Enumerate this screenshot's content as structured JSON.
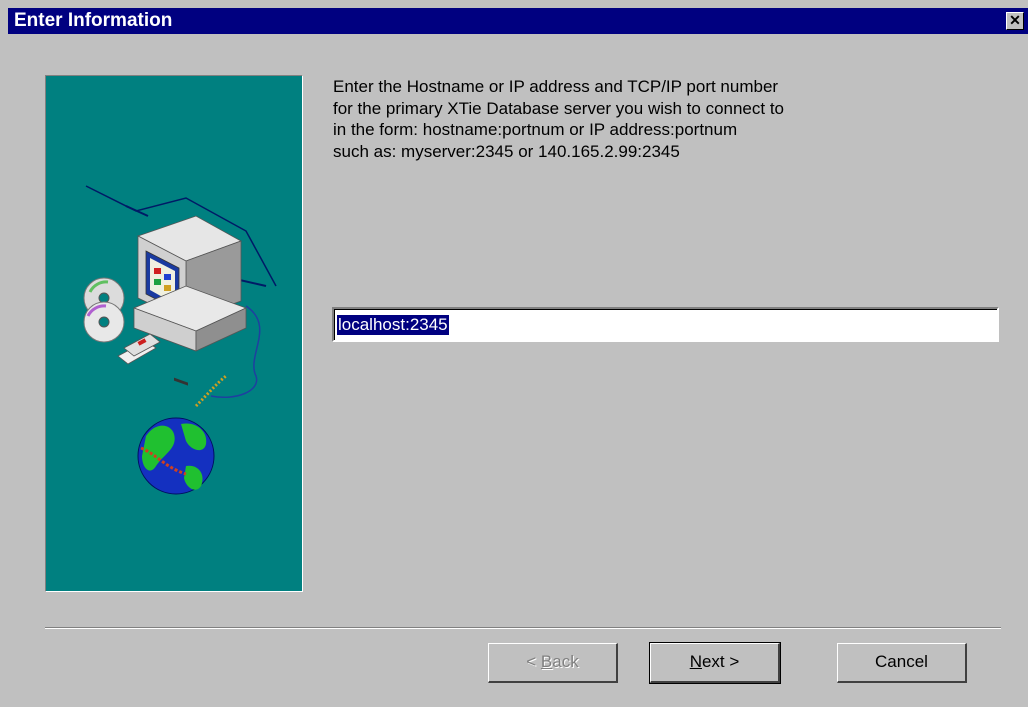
{
  "window": {
    "title": "Enter Information",
    "close_glyph": "✕"
  },
  "instructions": {
    "lines": [
      "Enter the Hostname or IP address and TCP/IP port number",
      "for the primary XTie Database server you wish to connect to",
      "in the form: hostname:portnum or IP address:portnum",
      "such as: myserver:2345 or 140.165.2.99:2345"
    ]
  },
  "host_field": {
    "value": "localhost:2345"
  },
  "buttons": {
    "back_prefix": "< ",
    "back_mnemonic": "B",
    "back_rest": "ack",
    "next_mnemonic": "N",
    "next_rest": "ext >",
    "cancel_label": "Cancel"
  },
  "colors": {
    "title_bar": "#000080",
    "dialog_bg": "#c0c0c0",
    "art_bg": "#008080",
    "selection": "#000080"
  },
  "icons": {
    "illustration": "computer-network-globe-illustration",
    "close": "close-icon"
  }
}
